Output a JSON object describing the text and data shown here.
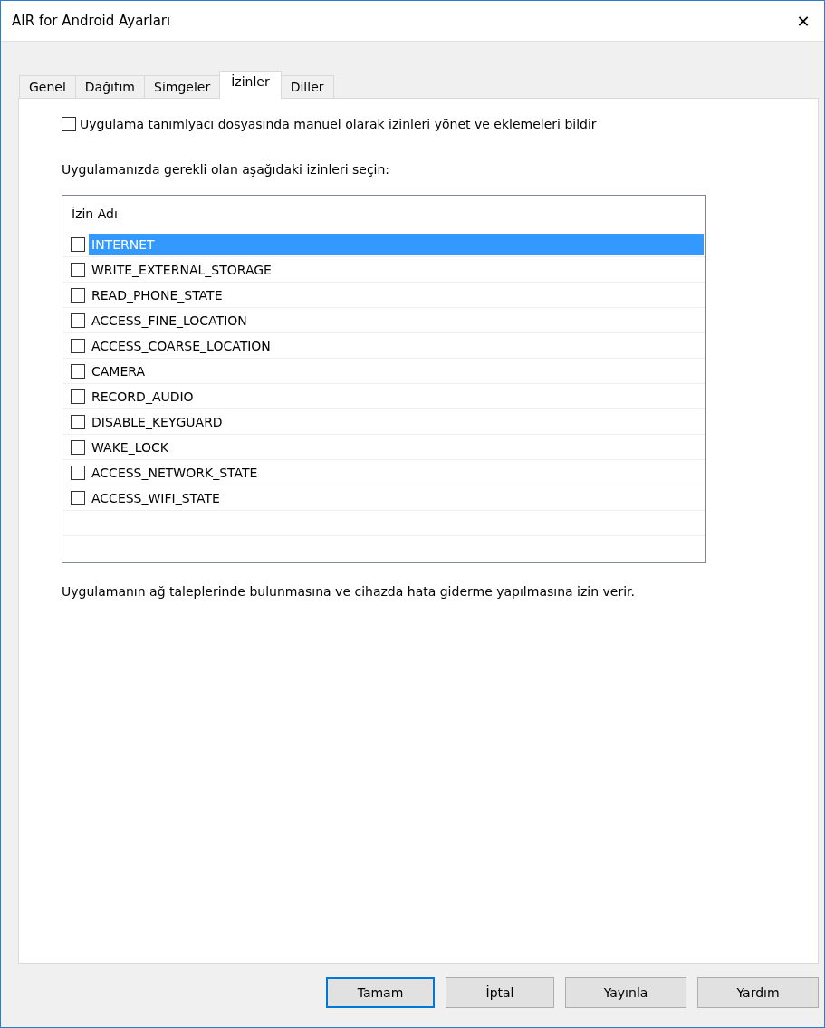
{
  "window": {
    "title": "AIR for Android Ayarları",
    "close": "✕"
  },
  "tabs": [
    {
      "label": "Genel",
      "selected": false
    },
    {
      "label": "Dağıtım",
      "selected": false
    },
    {
      "label": "Simgeler",
      "selected": false
    },
    {
      "label": "İzinler",
      "selected": true
    },
    {
      "label": "Diller",
      "selected": false
    }
  ],
  "manual_option": {
    "label": "Uygulama tanımlyacı dosyasında manuel olarak izinleri yönet ve eklemeleri bildir",
    "checked": false
  },
  "instruction": "Uygulamanızda gerekli olan aşağıdaki izinleri seçin:",
  "permissions": {
    "column": "İzin Adı",
    "rows": [
      {
        "name": "INTERNET",
        "checked": false,
        "selected": true
      },
      {
        "name": "WRITE_EXTERNAL_STORAGE",
        "checked": false,
        "selected": false
      },
      {
        "name": "READ_PHONE_STATE",
        "checked": false,
        "selected": false
      },
      {
        "name": "ACCESS_FINE_LOCATION",
        "checked": false,
        "selected": false
      },
      {
        "name": "ACCESS_COARSE_LOCATION",
        "checked": false,
        "selected": false
      },
      {
        "name": "CAMERA",
        "checked": false,
        "selected": false
      },
      {
        "name": "RECORD_AUDIO",
        "checked": false,
        "selected": false
      },
      {
        "name": "DISABLE_KEYGUARD",
        "checked": false,
        "selected": false
      },
      {
        "name": "WAKE_LOCK",
        "checked": false,
        "selected": false
      },
      {
        "name": "ACCESS_NETWORK_STATE",
        "checked": false,
        "selected": false
      },
      {
        "name": "ACCESS_WIFI_STATE",
        "checked": false,
        "selected": false
      }
    ]
  },
  "description": "Uygulamanın ağ taleplerinde bulunmasına ve cihazda hata giderme yapılmasına izin verir.",
  "buttons": [
    {
      "label": "Tamam",
      "default": true
    },
    {
      "label": "İptal",
      "default": false
    },
    {
      "label": "Yayınla",
      "default": false
    },
    {
      "label": "Yardım",
      "default": false
    }
  ]
}
